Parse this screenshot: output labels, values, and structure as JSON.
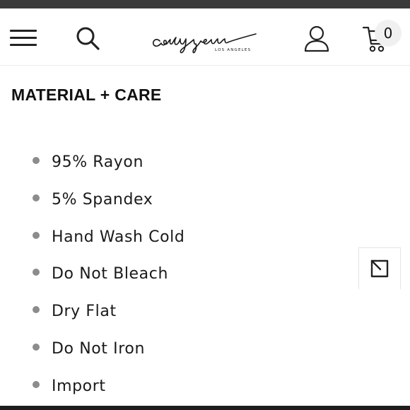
{
  "header": {
    "brand": "carlyjean",
    "brand_sub": "LOS ANGELES",
    "icons": {
      "menu": "hamburger-menu-icon",
      "search": "search-icon",
      "account": "user-icon",
      "cart": "cart-icon"
    },
    "cart_count": "0"
  },
  "section": {
    "title": "MATERIAL + CARE",
    "items": [
      {
        "label": "95% Rayon"
      },
      {
        "label": "5% Spandex"
      },
      {
        "label": "Hand Wash Cold"
      },
      {
        "label": "Do Not Bleach"
      },
      {
        "label": "Dry Flat"
      },
      {
        "label": "Do Not Iron"
      },
      {
        "label": "Import"
      }
    ]
  },
  "expand": {
    "icon": "expand-arrow-icon"
  },
  "colors": {
    "text": "#1a1a1a",
    "bullet": "#8c8c8c",
    "header_border": "#ececec"
  }
}
